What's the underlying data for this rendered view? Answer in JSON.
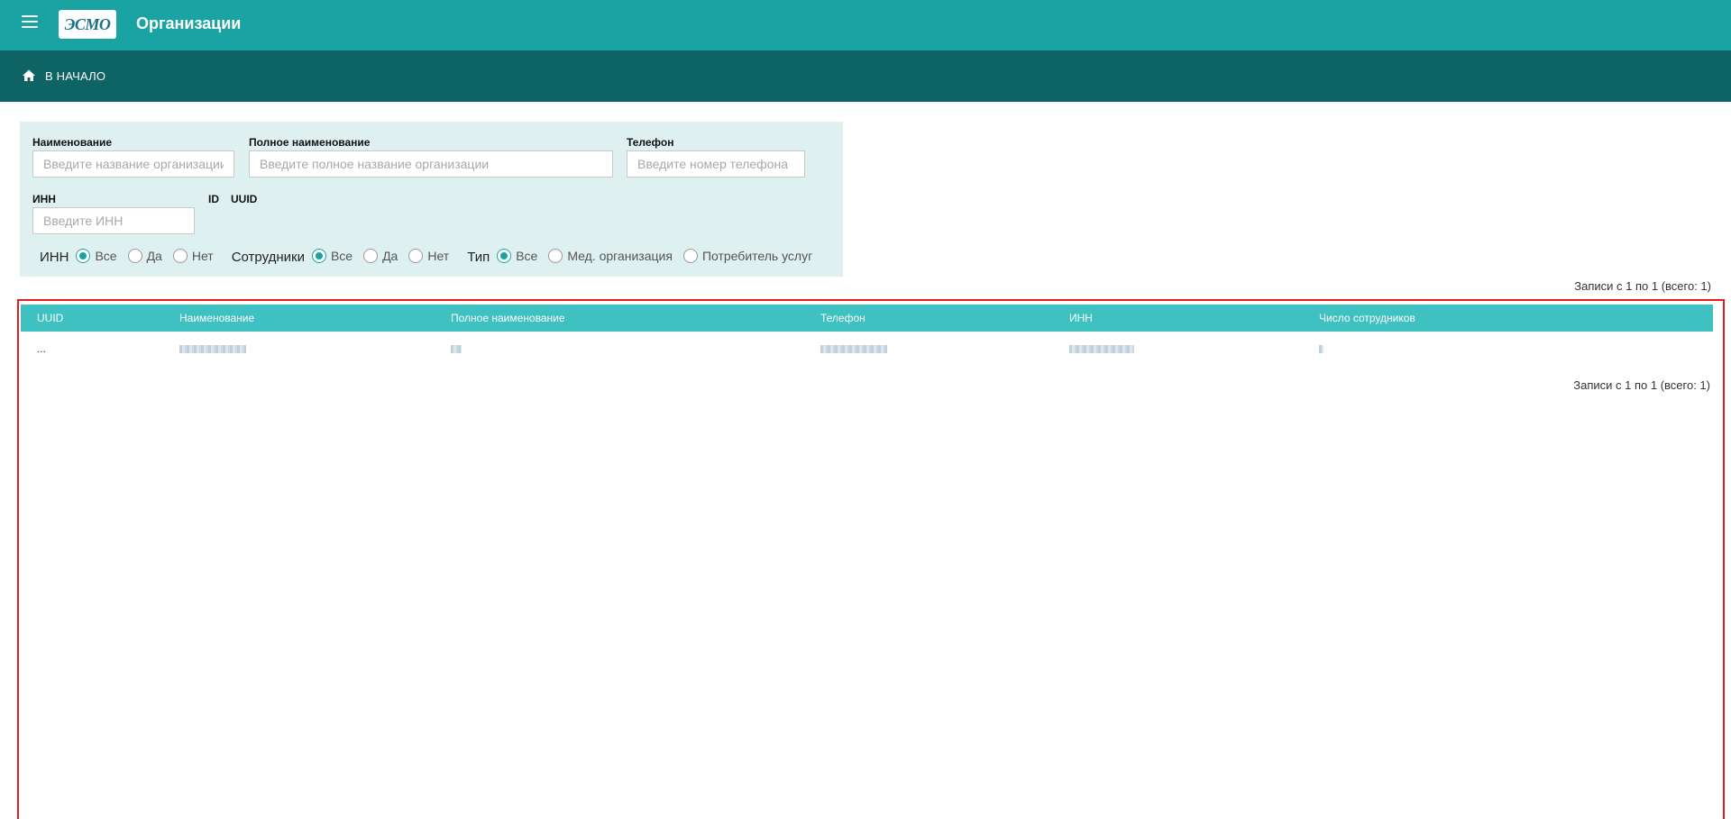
{
  "header": {
    "title": "Организации",
    "logo_text": "ЭСМО",
    "brand_color": "#1aa3a3",
    "nav_color": "#0e6464"
  },
  "nav": {
    "home_label": "В НАЧАЛО"
  },
  "filters": {
    "name": {
      "label": "Наименование",
      "placeholder": "Введите название организации"
    },
    "full_name": {
      "label": "Полное наименование",
      "placeholder": "Введите полное название организации"
    },
    "phone": {
      "label": "Телефон",
      "placeholder": "Введите номер телефона"
    },
    "inn": {
      "label": "ИНН",
      "placeholder": "Введите ИНН"
    },
    "id_label": "ID",
    "uuid_label": "UUID",
    "radio_groups": [
      {
        "title": "ИНН",
        "options": [
          "Все",
          "Да",
          "Нет"
        ],
        "selected": "Все"
      },
      {
        "title": "Сотрудники",
        "options": [
          "Все",
          "Да",
          "Нет"
        ],
        "selected": "Все"
      },
      {
        "title": "Тип",
        "options": [
          "Все",
          "Мед. организация",
          "Потребитель услуг"
        ],
        "selected": "Все"
      }
    ]
  },
  "records_label": "Записи с 1 по 1 (всего: 1)",
  "table": {
    "columns": [
      "UUID",
      "Наименование",
      "Полное наименование",
      "Телефон",
      "ИНН",
      "Число сотрудников"
    ],
    "rows": [
      {
        "uuid": "..."
      }
    ]
  }
}
